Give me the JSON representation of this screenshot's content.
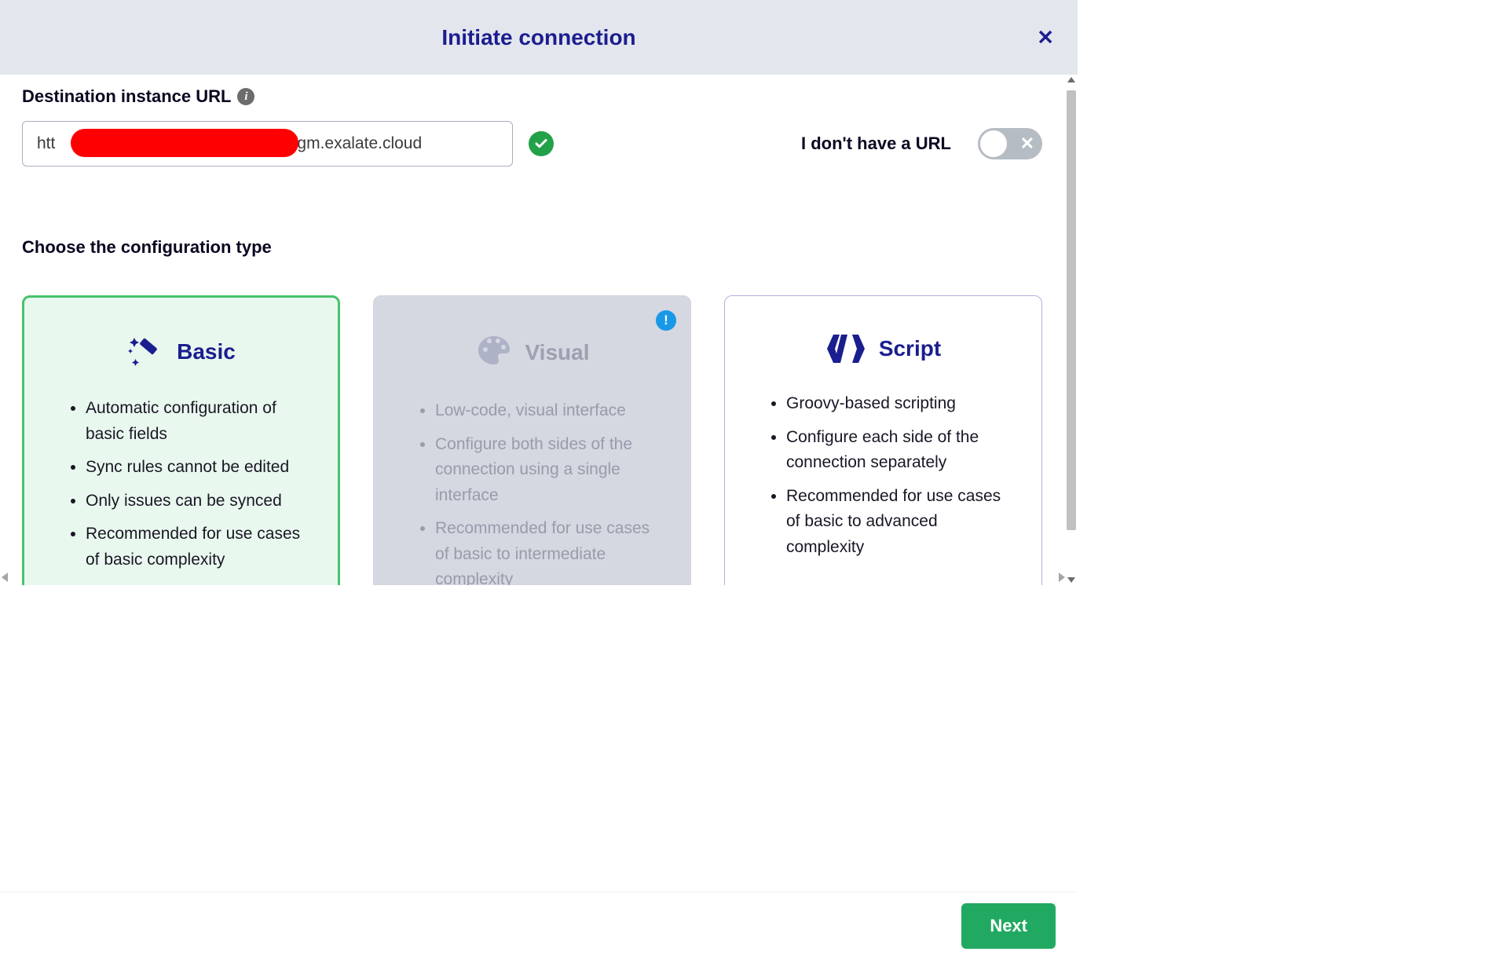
{
  "dialog": {
    "title": "Initiate connection"
  },
  "destination": {
    "label": "Destination instance URL",
    "value": "htt                                              pl-yfgm.exalate.cloud",
    "no_url_label": "I don't have a URL"
  },
  "config": {
    "heading": "Choose the configuration type",
    "cards": {
      "basic": {
        "title": "Basic",
        "bullets": [
          "Automatic configuration of basic fields",
          "Sync rules cannot be edited",
          "Only issues can be synced",
          "Recommended for use cases of basic complexity"
        ]
      },
      "visual": {
        "title": "Visual",
        "bullets": [
          "Low-code, visual interface",
          "Configure both sides of the connection using a single interface",
          "Recommended for use cases of basic to intermediate complexity"
        ]
      },
      "script": {
        "title": "Script",
        "bullets": [
          "Groovy-based scripting",
          "Configure each side of the connection separately",
          "Recommended for use cases of basic to advanced complexity"
        ]
      }
    }
  },
  "footer": {
    "next": "Next"
  }
}
